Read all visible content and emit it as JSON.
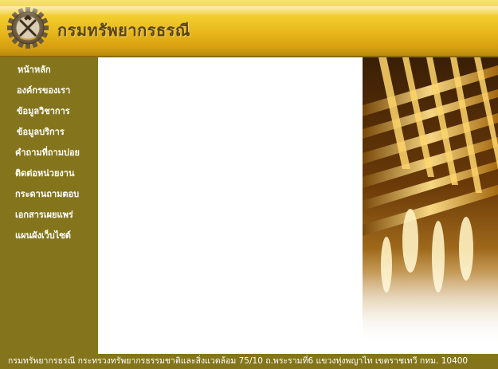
{
  "header": {
    "title": "กรมทรัพยากรธรณี",
    "logo_icon": "gear-tools-emblem-icon"
  },
  "sidebar": {
    "items": [
      {
        "label": "หน้าหลัก"
      },
      {
        "label": "องค์กรของเรา"
      },
      {
        "label": "ข้อมูลวิชาการ"
      },
      {
        "label": "ข้อมูลบริการ"
      },
      {
        "label": "คำถามที่ถามบ่อย"
      },
      {
        "label": "ติดต่อหน่วยงาน"
      },
      {
        "label": "กระดานถามตอบ"
      },
      {
        "label": "เอกสารเผยแพร่"
      },
      {
        "label": "แผนผังเว็บไซต์"
      }
    ]
  },
  "footer": {
    "text": "กรมทรัพยากรธรณี  กระทรวงทรัพยากรธรรมชาติและสิ่งแวดล้อม  75/10 ถ.พระรามที่6 แขวงทุ่งพญาไท  เขตราชเทวี  กทม. 10400"
  },
  "colors": {
    "header_gold": "#f2cd2d",
    "sidebar_olive": "#84751d",
    "title_brown": "#5a4410"
  }
}
